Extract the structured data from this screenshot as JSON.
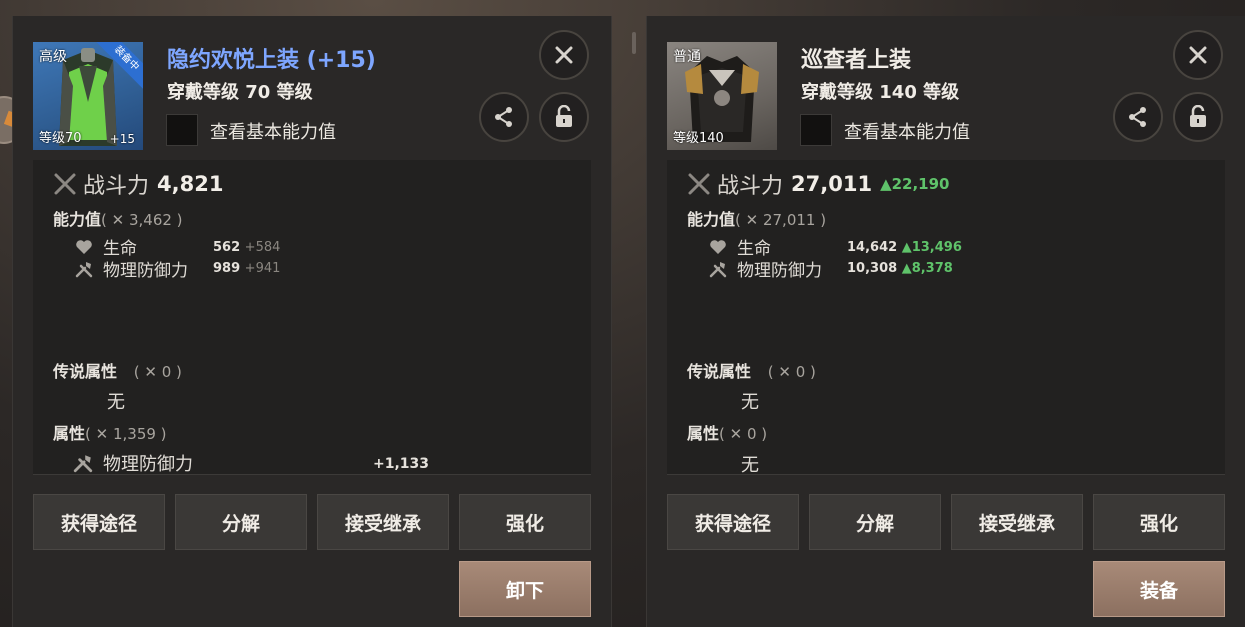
{
  "panels": [
    {
      "thumb": {
        "rarity": "高级",
        "level": "等级70",
        "plus": "+15",
        "ribbon": "装备中"
      },
      "name": "隐约欢悦上装 (+15)",
      "name_color": "#7ea6ff",
      "wear_level": "穿戴等级 70 等级",
      "view_basic": "查看基本能力值",
      "combat_label": "战斗力",
      "combat_value": "4,821",
      "combat_diff": "",
      "ability": {
        "title": "能力值",
        "sub": "( ✕ 3,462 )"
      },
      "stats": [
        {
          "name": "生命",
          "value": "562",
          "bonus": "+584",
          "icon": "heart-icon"
        },
        {
          "name": "物理防御力",
          "value": "989",
          "bonus": "+941",
          "icon": "shield-sword-icon"
        }
      ],
      "legend": {
        "title": "传说属性",
        "sub": "( ✕ 0 )",
        "value": "无"
      },
      "attr": {
        "title": "属性",
        "sub": "( ✕ 1,359 )",
        "line_name": "物理防御力",
        "line_value": "+1,133"
      },
      "buttons": [
        "获得途径",
        "分解",
        "接受继承",
        "强化"
      ],
      "primary": "卸下"
    },
    {
      "thumb": {
        "rarity": "普通",
        "level": "等级140",
        "plus": ""
      },
      "name": "巡查者上装",
      "name_color": "#f0ece6",
      "wear_level": "穿戴等级 140 等级",
      "view_basic": "查看基本能力值",
      "combat_label": "战斗力",
      "combat_value": "27,011",
      "combat_diff": "▲22,190",
      "ability": {
        "title": "能力值",
        "sub": "( ✕ 27,011 )"
      },
      "stats": [
        {
          "name": "生命",
          "value": "14,642",
          "bonus": "▲13,496",
          "icon": "heart-icon"
        },
        {
          "name": "物理防御力",
          "value": "10,308",
          "bonus": "▲8,378",
          "icon": "shield-sword-icon"
        }
      ],
      "legend": {
        "title": "传说属性",
        "sub": "( ✕ 0 )",
        "value": "无"
      },
      "attr": {
        "title": "属性",
        "sub": "( ✕ 0 )",
        "value": "无"
      },
      "buttons": [
        "获得途径",
        "分解",
        "接受继承",
        "强化"
      ],
      "primary": "装备"
    }
  ]
}
